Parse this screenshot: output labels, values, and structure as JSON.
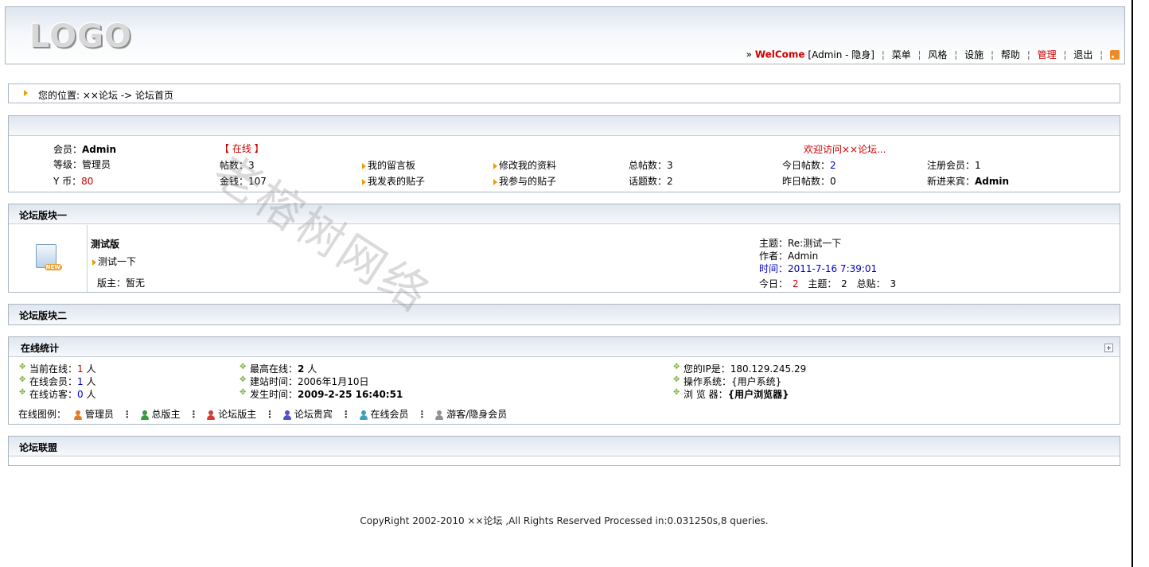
{
  "header": {
    "logo_text": "LOGO",
    "arrow": "»",
    "welcome": "WelCome",
    "user_status": "[Admin - 隐身]",
    "separator": "¦",
    "nav": [
      "菜单",
      "风格",
      "设施",
      "帮助",
      "管理",
      "退出"
    ],
    "rss_icon": "rss-icon"
  },
  "breadcrumb": {
    "text": "您的位置: ××论坛 -> 论坛首页"
  },
  "user_panel": {
    "member_label": "会员：",
    "member_value": "Admin",
    "online_status": "【 在线 】",
    "welcome_msg": "欢迎访问××论坛...",
    "level_label": "等级：",
    "level_value": "管理员",
    "posts_label": "帖数：",
    "posts_value": "3",
    "my_guestbook": "我的留言板",
    "edit_profile": "修改我的资料",
    "total_posts_label": "总帖数：",
    "total_posts_value": "3",
    "today_posts_label": "今日帖数：",
    "today_posts_value": "2",
    "reg_members_label": "注册会员：",
    "reg_members_value": "1",
    "ycoin_label": "Y 币：",
    "ycoin_value": "80",
    "money_label": "金钱：",
    "money_value": "107",
    "my_posts": "我发表的贴子",
    "my_participated": "我参与的贴子",
    "topics_label": "话题数：",
    "topics_value": "2",
    "yesterday_label": "昨日帖数：",
    "yesterday_value": "0",
    "newest_label": "新进来宾：",
    "newest_value": "Admin"
  },
  "forum_block_1": {
    "title": "论坛版块一",
    "forum_name": "测试版",
    "forum_desc": "测试一下",
    "moderator": "版主：暂无",
    "last_topic": "主题：Re:测试一下",
    "last_author": "作者：Admin",
    "last_time_label": "时间：",
    "last_time_value": "2011-7-16 7:39:01",
    "today_label": "今日：",
    "today_value": "2",
    "topics_label": "主题：",
    "topics_value": "2",
    "total_label": "总贴：",
    "total_value": "3"
  },
  "forum_block_2": {
    "title": "论坛版块二"
  },
  "online_stats": {
    "title": "在线统计",
    "current_online_label": "当前在线：",
    "current_online_value": "1",
    "online_members_label": "在线会员：",
    "online_members_value": "1",
    "online_guests_label": "在线访客：",
    "online_guests_value": "0",
    "unit": "人",
    "max_online_label": "最高在线：",
    "max_online_value": "2",
    "site_date_label": "建站时间：",
    "site_date_value": "2006年1月10日",
    "occurred_label": "发生时间：",
    "occurred_value": "2009-2-25 16:40:51",
    "ip_label": "您的IP是：",
    "ip_value": "180.129.245.29",
    "os_label": "操作系统：",
    "os_value": "{用户系统}",
    "browser_label": "浏 览 器：",
    "browser_value": "{用户浏览器}",
    "legend_label": "在线图例：",
    "legend_items": [
      {
        "label": "管理员",
        "color": "#e07a2a"
      },
      {
        "label": "总版主",
        "color": "#3a9a3a"
      },
      {
        "label": "论坛版主",
        "color": "#d04030"
      },
      {
        "label": "论坛贵宾",
        "color": "#5050c8"
      },
      {
        "label": "在线会员",
        "color": "#3aa0c0"
      },
      {
        "label": "游客/隐身会员",
        "color": "#909090"
      }
    ],
    "legend_sep": "⋮"
  },
  "alliance": {
    "title": "论坛联盟"
  },
  "footer": {
    "text": "CopyRight 2002-2010 ××论坛 ,All Rights Reserved Processed in:0.031250s,8 queries."
  },
  "watermark": {
    "text": "老榕树网络"
  }
}
